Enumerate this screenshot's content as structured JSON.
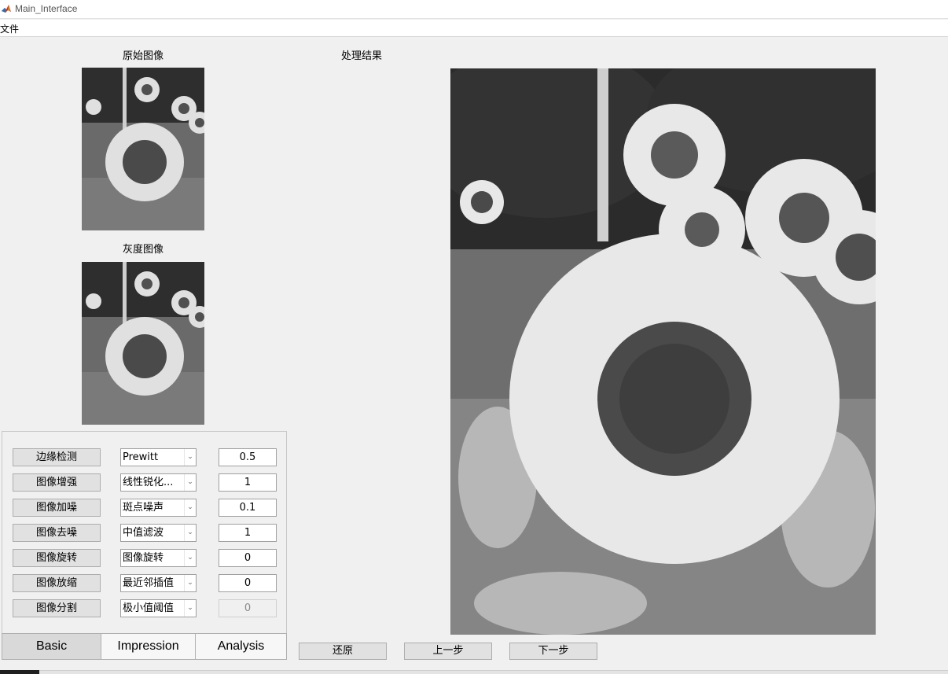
{
  "window": {
    "title": "Main_Interface"
  },
  "menu": {
    "file": "文件"
  },
  "captions": {
    "original": "原始图像",
    "gray": "灰度图像",
    "result": "处理结果"
  },
  "rows": [
    {
      "button": "边缘检测",
      "select": "Prewitt",
      "value": "0.5",
      "value_enabled": true
    },
    {
      "button": "图像增强",
      "select": "线性锐化...",
      "value": "1",
      "value_enabled": true
    },
    {
      "button": "图像加噪",
      "select": "斑点噪声",
      "value": "0.1",
      "value_enabled": true
    },
    {
      "button": "图像去噪",
      "select": "中值滤波",
      "value": "1",
      "value_enabled": true
    },
    {
      "button": "图像旋转",
      "select": "图像旋转",
      "value": "0",
      "value_enabled": true
    },
    {
      "button": "图像放缩",
      "select": "最近邻插值",
      "value": "0",
      "value_enabled": true
    },
    {
      "button": "图像分割",
      "select": "极小值阈值",
      "value": "0",
      "value_enabled": false
    }
  ],
  "tabs": [
    {
      "label": "Basic",
      "active": true
    },
    {
      "label": "Impression",
      "active": false
    },
    {
      "label": "Analysis",
      "active": false
    }
  ],
  "actions": {
    "restore": "还原",
    "prev": "上一步",
    "next": "下一步"
  },
  "icons": {
    "app": "matlab-logo-icon",
    "dropdown": "chevron-down-icon"
  },
  "colors": {
    "background": "#f0f0f0",
    "button_face": "#e1e1e1",
    "active_tab": "#d9d9d9"
  }
}
